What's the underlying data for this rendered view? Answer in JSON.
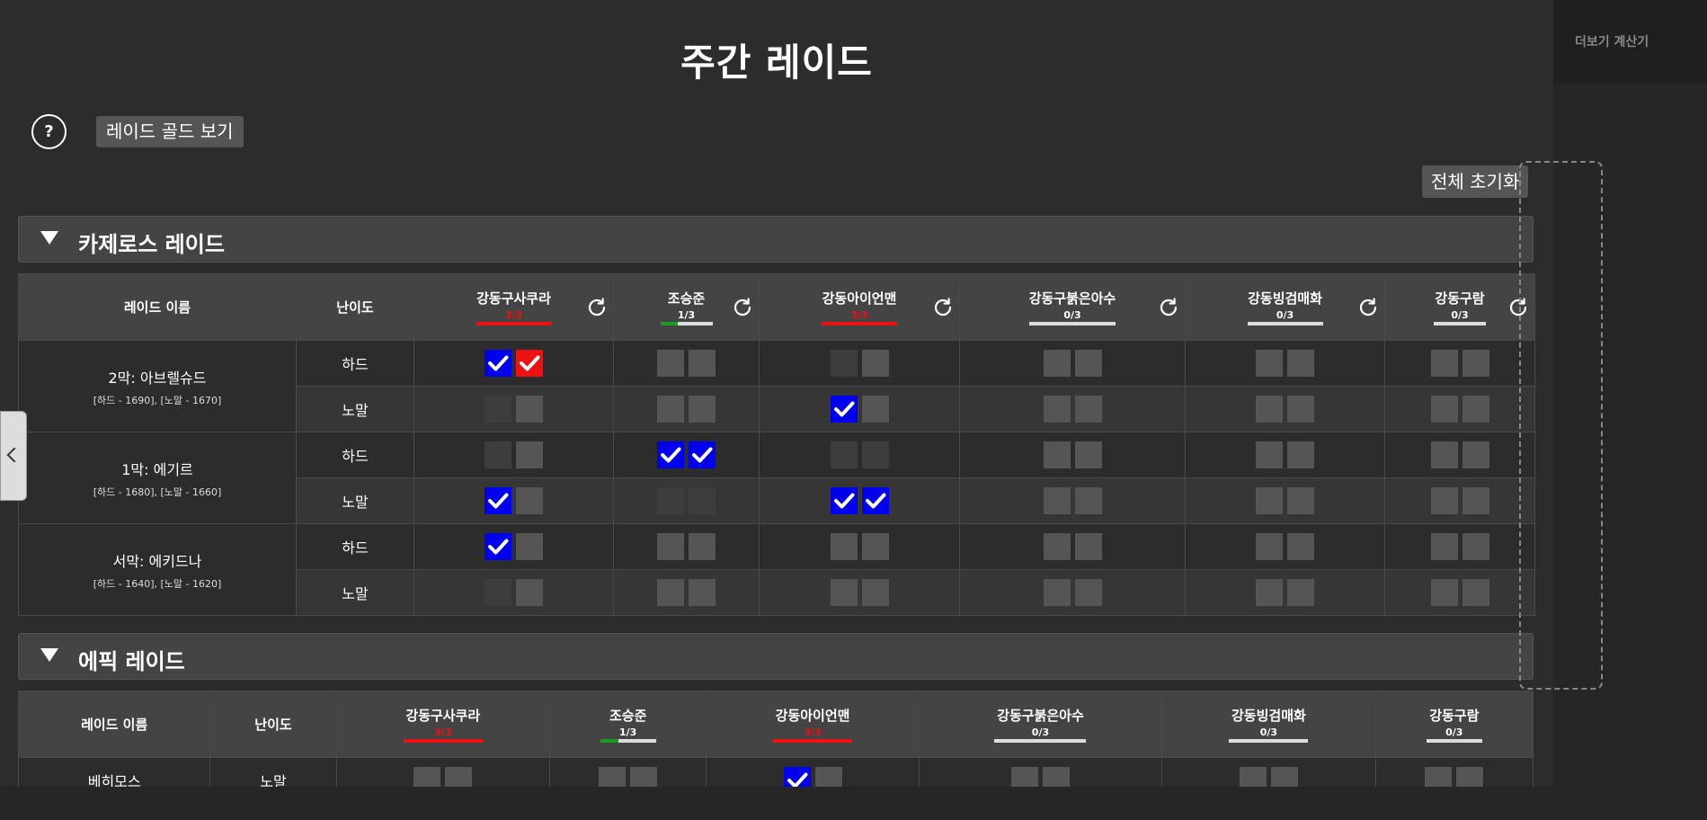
{
  "page": {
    "title": "주간 레이드"
  },
  "toolbar": {
    "help_label": "?",
    "gold_button": "레이드 골드 보기",
    "reset_all": "전체 초기화"
  },
  "side_panel": {
    "title": "더보기 계산기"
  },
  "colors": {
    "check_blue": "#0000ee",
    "check_red": "#ee1111",
    "progress_red": "#ee1111",
    "progress_green": "#1a9a1a",
    "progress_track": "#dddddd"
  },
  "sections": [
    {
      "title": "카제로스 레이드",
      "headers": {
        "raid_name": "레이드 이름",
        "difficulty": "난이도"
      },
      "characters": [
        {
          "name": "강동구사쿠라",
          "progress": "3/3",
          "done": 3,
          "total": 3,
          "status": "full"
        },
        {
          "name": "조승준",
          "progress": "1/3",
          "done": 1,
          "total": 3,
          "status": "partial"
        },
        {
          "name": "강동아이언맨",
          "progress": "3/3",
          "done": 3,
          "total": 3,
          "status": "full"
        },
        {
          "name": "강동구붉은아수",
          "progress": "0/3",
          "done": 0,
          "total": 3,
          "status": "none"
        },
        {
          "name": "강동빙검매화",
          "progress": "0/3",
          "done": 0,
          "total": 3,
          "status": "none"
        },
        {
          "name": "강동구람",
          "progress": "0/3",
          "done": 0,
          "total": 3,
          "status": "none"
        }
      ],
      "raids": [
        {
          "name": "2막: 아브렐슈드",
          "rewards": "[하드 - 1690], [노말 - 1670]",
          "rows": [
            {
              "difficulty": "하드",
              "cells": [
                [
                  "blue",
                  "red"
                ],
                [
                  "grey",
                  "grey"
                ],
                [
                  "dark",
                  "grey"
                ],
                [
                  "grey",
                  "grey"
                ],
                [
                  "grey",
                  "grey"
                ],
                [
                  "grey",
                  "grey"
                ]
              ]
            },
            {
              "difficulty": "노말",
              "cells": [
                [
                  "dark",
                  "grey"
                ],
                [
                  "grey",
                  "grey"
                ],
                [
                  "blue",
                  "grey"
                ],
                [
                  "grey",
                  "grey"
                ],
                [
                  "grey",
                  "grey"
                ],
                [
                  "grey",
                  "grey"
                ]
              ]
            }
          ]
        },
        {
          "name": "1막: 에기르",
          "rewards": "[하드 - 1680], [노말 - 1660]",
          "rows": [
            {
              "difficulty": "하드",
              "cells": [
                [
                  "dark",
                  "grey"
                ],
                [
                  "blue",
                  "blue"
                ],
                [
                  "dark",
                  "dark"
                ],
                [
                  "grey",
                  "grey"
                ],
                [
                  "grey",
                  "grey"
                ],
                [
                  "grey",
                  "grey"
                ]
              ]
            },
            {
              "difficulty": "노말",
              "cells": [
                [
                  "blue",
                  "grey"
                ],
                [
                  "dark",
                  "dark"
                ],
                [
                  "blue",
                  "blue"
                ],
                [
                  "grey",
                  "grey"
                ],
                [
                  "grey",
                  "grey"
                ],
                [
                  "grey",
                  "grey"
                ]
              ]
            }
          ]
        },
        {
          "name": "서막: 에키드나",
          "rewards": "[하드 - 1640], [노말 - 1620]",
          "rows": [
            {
              "difficulty": "하드",
              "cells": [
                [
                  "blue",
                  "grey"
                ],
                [
                  "grey",
                  "grey"
                ],
                [
                  "grey",
                  "grey"
                ],
                [
                  "grey",
                  "grey"
                ],
                [
                  "grey",
                  "grey"
                ],
                [
                  "grey",
                  "grey"
                ]
              ]
            },
            {
              "difficulty": "노말",
              "cells": [
                [
                  "dark",
                  "grey"
                ],
                [
                  "grey",
                  "grey"
                ],
                [
                  "grey",
                  "grey"
                ],
                [
                  "grey",
                  "grey"
                ],
                [
                  "grey",
                  "grey"
                ],
                [
                  "grey",
                  "grey"
                ]
              ]
            }
          ]
        }
      ]
    },
    {
      "title": "에픽 레이드",
      "headers": {
        "raid_name": "레이드 이름",
        "difficulty": "난이도"
      },
      "characters": [
        {
          "name": "강동구사쿠라",
          "progress": "3/3",
          "done": 3,
          "total": 3,
          "status": "full"
        },
        {
          "name": "조승준",
          "progress": "1/3",
          "done": 1,
          "total": 3,
          "status": "partial"
        },
        {
          "name": "강동아이언맨",
          "progress": "3/3",
          "done": 3,
          "total": 3,
          "status": "full"
        },
        {
          "name": "강동구붉은아수",
          "progress": "0/3",
          "done": 0,
          "total": 3,
          "status": "none"
        },
        {
          "name": "강동빙검매화",
          "progress": "0/3",
          "done": 0,
          "total": 3,
          "status": "none"
        },
        {
          "name": "강동구람",
          "progress": "0/3",
          "done": 0,
          "total": 3,
          "status": "none"
        }
      ],
      "raids": [
        {
          "name": "베히모스",
          "rows": [
            {
              "difficulty": "노말",
              "cells": [
                [
                  "grey",
                  "grey"
                ],
                [
                  "grey",
                  "grey"
                ],
                [
                  "blue",
                  "grey"
                ],
                [
                  "grey",
                  "grey"
                ],
                [
                  "grey",
                  "grey"
                ],
                [
                  "grey",
                  "grey"
                ]
              ]
            }
          ]
        }
      ]
    }
  ]
}
